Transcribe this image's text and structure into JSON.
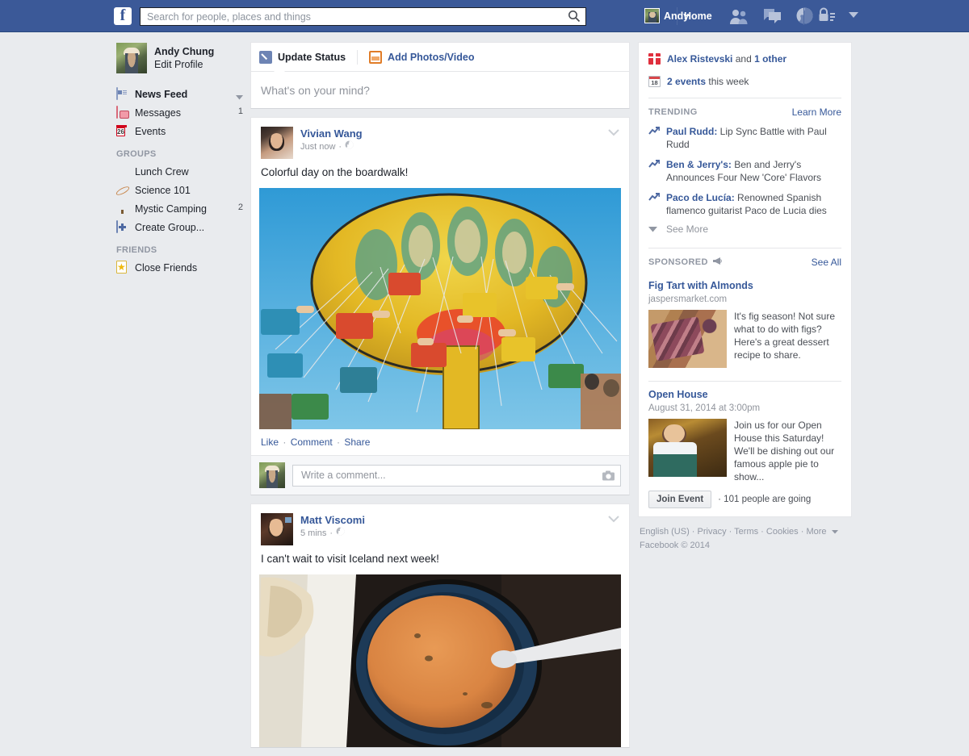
{
  "topbar": {
    "logo": "f",
    "logo_icon": "facebook-logo-icon",
    "search_placeholder": "Search for people, places and things",
    "search_value": "",
    "search_icon": "search-icon",
    "profile_name": "Andy",
    "home_label": "Home",
    "icons": [
      "friend-requests-icon",
      "messages-icon",
      "notifications-globe-icon",
      "privacy-lock-icon",
      "account-chevron-down-icon"
    ],
    "brand_color": "#3b5998"
  },
  "sidebar": {
    "profile": {
      "name": "Andy Chung",
      "edit": "Edit Profile"
    },
    "main_items": [
      {
        "label": "News Feed",
        "icon": "news-feed-icon",
        "count": "",
        "caret": true,
        "bold": true
      },
      {
        "label": "Messages",
        "icon": "messages-icon",
        "count": "1",
        "caret": false,
        "bold": false
      },
      {
        "label": "Events",
        "icon": "events-calendar-icon",
        "count": "",
        "caret": false,
        "bold": false,
        "icon_text": "26"
      }
    ],
    "groups_header": "GROUPS",
    "groups": [
      {
        "label": "Lunch Crew",
        "icon": "flower-icon",
        "count": ""
      },
      {
        "label": "Science 101",
        "icon": "planet-icon",
        "count": ""
      },
      {
        "label": "Mystic Camping",
        "icon": "tree-icon",
        "count": "2"
      },
      {
        "label": "Create Group...",
        "icon": "create-group-plus-icon",
        "count": ""
      }
    ],
    "friends_header": "FRIENDS",
    "friends": [
      {
        "label": "Close Friends",
        "icon": "star-icon",
        "count": ""
      }
    ]
  },
  "composer": {
    "tabs": [
      {
        "label": "Update Status",
        "icon": "pencil-icon",
        "active": true
      },
      {
        "label": "Add Photos/Video",
        "icon": "photo-icon",
        "active": false
      }
    ],
    "placeholder": "What's on your mind?",
    "value": ""
  },
  "posts": [
    {
      "author": "Vivian Wang",
      "time": "Just now",
      "privacy_icon": "public-globe-icon",
      "text": "Colorful day on the boardwalk!",
      "photo_alt": "swing-carousel-ride-photo",
      "actions": {
        "like": "Like",
        "comment": "Comment",
        "share": "Share",
        "sep": "·"
      },
      "comment_placeholder": "Write a comment...",
      "comment_value": "",
      "camera_icon": "camera-icon",
      "caret_icon": "chevron-down-icon"
    },
    {
      "author": "Matt Viscomi",
      "time": "5 mins",
      "privacy_icon": "public-globe-icon",
      "text": "I can't wait to visit Iceland next week!",
      "photo_alt": "soup-bowl-with-bread-photo",
      "caret_icon": "chevron-down-icon"
    }
  ],
  "rail": {
    "notices": [
      {
        "icon": "birthday-gift-icon",
        "link": "Alex Ristevski",
        "rest": " and ",
        "bold2": "1 other",
        "tail": ""
      },
      {
        "icon": "events-calendar-icon",
        "icon_text": "18",
        "link": "2 events",
        "rest": " this week",
        "bold2": "",
        "tail": ""
      }
    ],
    "trending": {
      "header": "TRENDING",
      "link": "Learn More",
      "items": [
        {
          "icon": "trending-arrow-icon",
          "topic": "Paul Rudd:",
          "desc": " Lip Sync Battle with Paul Rudd"
        },
        {
          "icon": "trending-arrow-icon",
          "topic": "Ben & Jerry's:",
          "desc": " Ben and Jerry's Announces Four New 'Core' Flavors"
        },
        {
          "icon": "trending-arrow-icon",
          "topic": "Paco de Lucía:",
          "desc": " Renowned Spanish flamenco guitarist Paco de Lucia dies"
        }
      ],
      "see_more": "See More",
      "see_more_icon": "chevron-down-icon"
    },
    "sponsored": {
      "header": "SPONSORED",
      "header_icon": "megaphone-icon",
      "link": "See All",
      "ads": [
        {
          "title": "Fig Tart with Almonds",
          "sub": "jaspersmarket.com",
          "copy": "It's fig season! Not sure what to do with figs? Here's a great dessert recipe to share.",
          "image_alt": "fig-tart-photo"
        },
        {
          "title": "Open House",
          "sub": "August 31, 2014 at 3:00pm",
          "copy": "Join us for our Open House this Saturday! We'll be dishing out our famous apple pie to show...",
          "image_alt": "grocer-in-apron-photo",
          "button": "Join Event",
          "going": "· 101 people are going"
        }
      ]
    },
    "footer": {
      "links": [
        "English (US)",
        "Privacy",
        "Terms",
        "Cookies",
        "More"
      ],
      "more_caret_icon": "chevron-down-icon",
      "copyright": "Facebook © 2014",
      "sep": " · "
    }
  }
}
